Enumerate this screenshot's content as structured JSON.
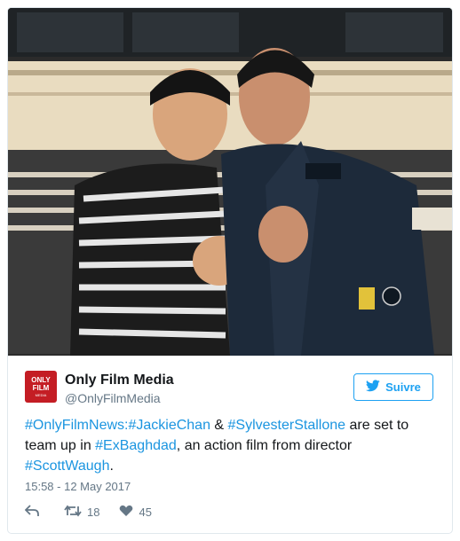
{
  "account": {
    "name": "Only Film Media",
    "handle": "@OnlyFilmMedia",
    "avatar_text": "ONLY FILM",
    "avatar_subtext": "MEDIA"
  },
  "follow_label": "Suivre",
  "tweet": {
    "parts": [
      {
        "text": "#OnlyFilmNews:",
        "link": true
      },
      {
        "text": "#JackieChan",
        "link": true
      },
      {
        "text": " & ",
        "link": false
      },
      {
        "text": "#SylvesterStallone",
        "link": true
      },
      {
        "text": " are set to team up in ",
        "link": false
      },
      {
        "text": "#ExBaghdad",
        "link": true
      },
      {
        "text": ", an action film from director ",
        "link": false
      },
      {
        "text": "#ScottWaugh",
        "link": true
      },
      {
        "text": ".",
        "link": false
      }
    ]
  },
  "timestamp": "15:58 - 12 May 2017",
  "actions": {
    "retweets": "18",
    "likes": "45"
  },
  "colors": {
    "link": "#1b95e0",
    "brand_blue": "#1da1f2",
    "avatar_red": "#c41d24"
  }
}
